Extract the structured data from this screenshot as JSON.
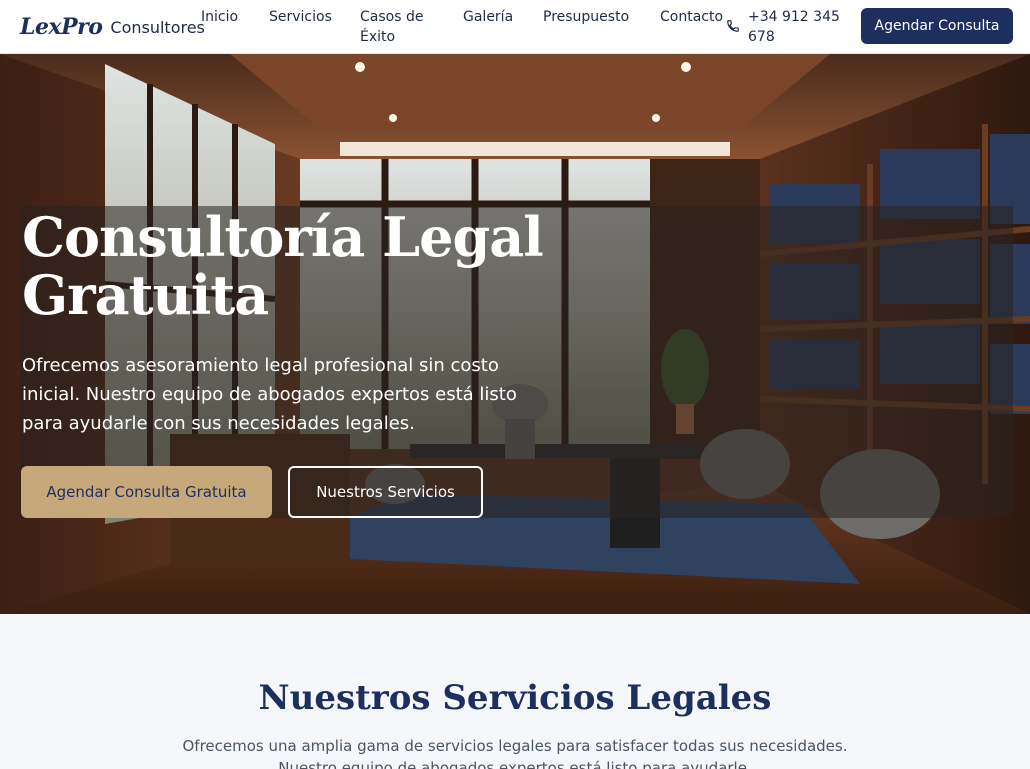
{
  "brand": {
    "script": "LexPro",
    "word": "Consultores"
  },
  "nav": [
    {
      "label": "Inicio"
    },
    {
      "label": "Servicios"
    },
    {
      "label": "Casos de Éxito"
    },
    {
      "label": "Galería"
    },
    {
      "label": "Presupuesto"
    },
    {
      "label": "Contacto"
    }
  ],
  "phone": {
    "icon": "phone-icon",
    "number": "+34 912 345 678"
  },
  "header_cta": "Agendar Consulta",
  "hero": {
    "title": "Consultoría Legal Gratuita",
    "description": "Ofrecemos asesoramiento legal profesional sin costo inicial. Nuestro equipo de abogados expertos está listo para ayudarle con sus necesidades legales.",
    "primary_button": "Agendar Consulta Gratuita",
    "secondary_button": "Nuestros Servicios"
  },
  "services": {
    "title": "Nuestros Servicios Legales",
    "description": "Ofrecemos una amplia gama de servicios legales para satisfacer todas sus necesidades. Nuestro equipo de abogados expertos está listo para ayudarle."
  },
  "colors": {
    "navy": "#1c2f5e",
    "gold": "#c7a87a",
    "section_bg": "#f6f7fa"
  }
}
